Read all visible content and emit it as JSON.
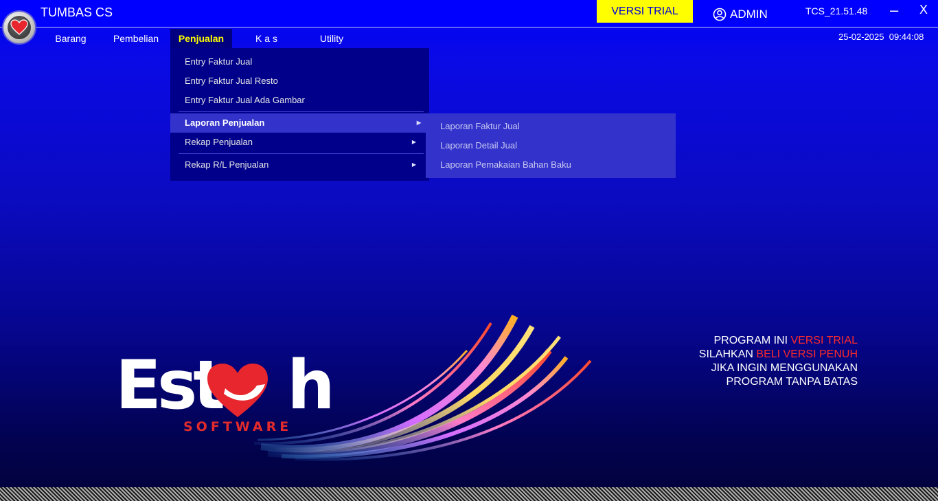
{
  "app": {
    "title": "TUMBAS CS",
    "trial_badge": "VERSI TRIAL",
    "user": "ADMIN",
    "version": "TCS_21.51.48",
    "minimize": "–",
    "close": "X",
    "date": "25-02-2025",
    "time": "09:44:08"
  },
  "menubar": {
    "items": [
      {
        "label": "Barang"
      },
      {
        "label": "Pembelian"
      },
      {
        "label": "Penjualan"
      },
      {
        "label": "K a s"
      },
      {
        "label": "Utility"
      }
    ],
    "active": "Penjualan"
  },
  "dropdown": {
    "items": [
      {
        "label": "Entry Faktur Jual"
      },
      {
        "label": "Entry Faktur Jual Resto"
      },
      {
        "label": "Entry Faktur Jual Ada Gambar"
      },
      {
        "label": "Laporan Penjualan"
      },
      {
        "label": "Rekap Penjualan"
      },
      {
        "label": "Rekap R/L Penjualan"
      }
    ],
    "highlighted": "Laporan Penjualan"
  },
  "submenu": {
    "items": [
      {
        "label": "Laporan Faktur Jual"
      },
      {
        "label": "Laporan Detail Jual"
      },
      {
        "label": "Laporan Pemakaian Bahan Baku"
      }
    ]
  },
  "brand": {
    "name_left": "Est",
    "name_right": "h",
    "sub": "SOFTWARE"
  },
  "notice": {
    "line1_a": "PROGRAM INI ",
    "line1_b": "VERSI TRIAL",
    "line2_a": "SILAHKAN ",
    "line2_b": "BELI VERSI PENUH",
    "line3": "JIKA INGIN MENGGUNAKAN",
    "line4": "PROGRAM TANPA BATAS"
  },
  "colors": {
    "titlebar": "#0000ff",
    "trial_badge_bg": "#ffff00",
    "menu_active_bg": "#000080",
    "menu_active_text": "#ffff00",
    "dropdown_bg": "#00008a",
    "submenu_bg": "#3333cc",
    "notice_red": "#ff2a2a",
    "brand_red": "#e32b2b"
  },
  "icons": [
    "app-heart-logo-icon",
    "user-circle-icon",
    "submenu-arrow-icon"
  ]
}
